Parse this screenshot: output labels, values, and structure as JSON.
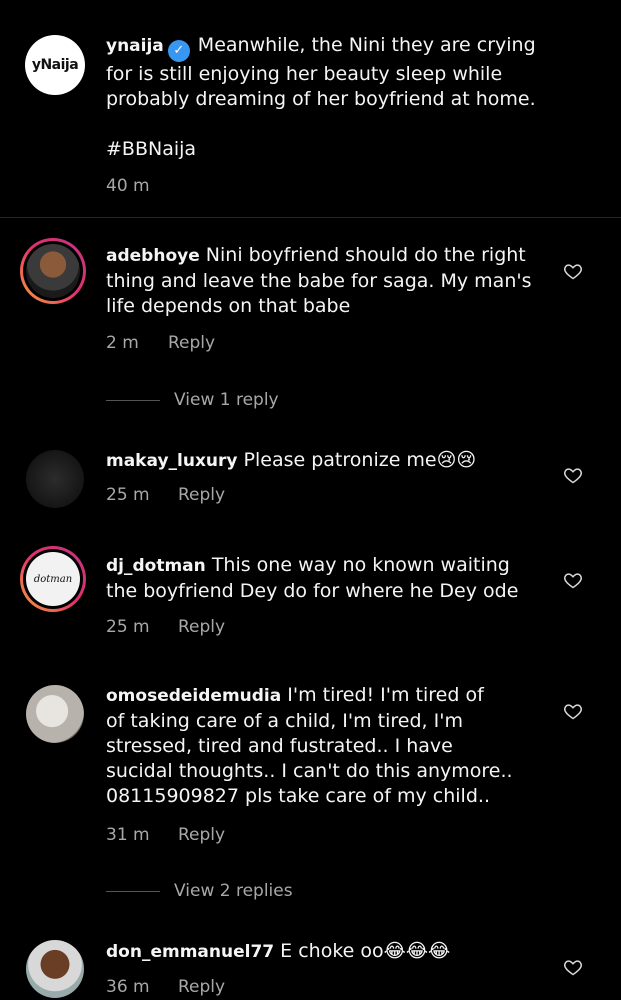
{
  "caption": {
    "username": "ynaija",
    "text_lines": [
      "Meanwhile, the Nini they are crying",
      "for is still enjoying her beauty sleep while",
      "probably dreaming of her boyfriend at home."
    ],
    "hashtag": "#BBNaija",
    "time": "40 m",
    "logo": "ynaija"
  },
  "comments": [
    {
      "username": "adebhoye",
      "text_lines": [
        "Nini boyfriend should do the right",
        "thing and leave the babe for saga. My man's",
        "life depends on that babe"
      ],
      "time": "2 m",
      "reply": "Reply",
      "view_replies": "View 1 reply"
    },
    {
      "username": "makay_luxury",
      "text_lines": [
        "Please patronize me😢😢"
      ],
      "time": "25 m",
      "reply": "Reply"
    },
    {
      "username": "dj_dotman",
      "text_lines": [
        "This one way no known waiting",
        "the boyfriend Dey do for where he Dey ode"
      ],
      "time": "25 m",
      "reply": "Reply"
    },
    {
      "username": "omosedeidemudia",
      "text_lines": [
        "I'm tired! I'm tired of",
        "of taking care of a child, I'm tired, I'm",
        "stressed, tired and fustrated.. I have",
        "sucidal thoughts.. I can't do this anymore..",
        "08115909827 pls take care of my child.."
      ],
      "time": "31 m",
      "reply": "Reply",
      "view_replies": "View 2 replies"
    },
    {
      "username": "don_emmanuel77",
      "text_lines": [
        "E choke oo😂😂😂"
      ],
      "time": "36 m",
      "reply": "Reply"
    }
  ],
  "icons": {
    "verified": "verified-badge-icon",
    "like": "heart-icon"
  },
  "colors": {
    "background": "#000000",
    "secondary_text": "#a8a8a8",
    "verified": "#3897f0"
  }
}
